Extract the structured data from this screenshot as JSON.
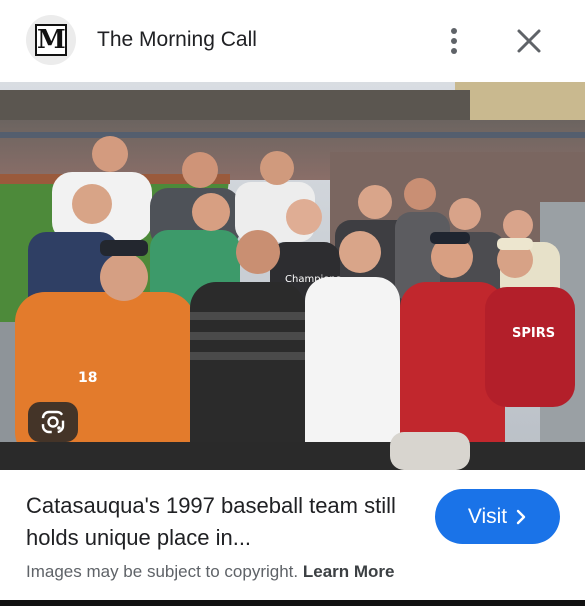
{
  "header": {
    "logo_letter": "M",
    "site_name": "The Morning Call",
    "more_icon": "more-vert-icon",
    "close_icon": "close-icon"
  },
  "photo": {
    "shirt_text_left": "18",
    "shirt_text_mid": "Champions",
    "shirt_text_right": "SPIRS"
  },
  "caption": {
    "title": "Catasauqua's 1997 baseball team still holds unique place in...",
    "visit_label": "Visit",
    "copyright_text": "Images may be subject to copyright.",
    "learn_more": "Learn More"
  },
  "colors": {
    "accent": "#1a73e8",
    "text": "#202124",
    "muted": "#5f6368"
  }
}
